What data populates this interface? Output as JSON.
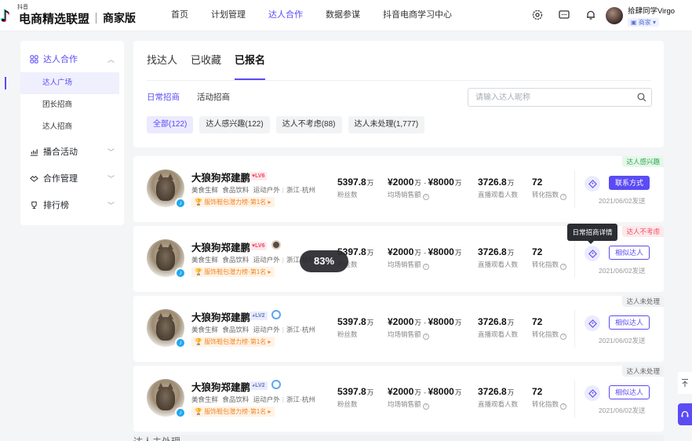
{
  "header": {
    "logo_small": "抖音",
    "brand": "电商精选联盟",
    "sub_brand": "商家版",
    "nav": [
      "首页",
      "计划管理",
      "达人合作",
      "数据参谋",
      "抖音电商学习中心"
    ],
    "nav_active": 2,
    "icons": [
      "gear-icon",
      "message-icon",
      "bell-icon"
    ],
    "user": {
      "name": "拾肆同学Virgo",
      "role": "商家"
    }
  },
  "sidebar": {
    "groups": [
      {
        "label": "达人合作",
        "icon": "grid-icon",
        "expanded": true,
        "active": true,
        "items": [
          "达人广场",
          "团长招商",
          "达人招商"
        ],
        "active_item": 0
      },
      {
        "label": "播合活动",
        "icon": "chart-icon",
        "expanded": false
      },
      {
        "label": "合作管理",
        "icon": "handshake-icon",
        "expanded": false
      },
      {
        "label": "排行榜",
        "icon": "trophy-icon",
        "expanded": false
      }
    ]
  },
  "main": {
    "tabs": [
      "找达人",
      "已收藏",
      "已报名"
    ],
    "active_tab": 2,
    "subtabs": [
      "日常招商",
      "活动招商"
    ],
    "active_subtab": 0,
    "search_placeholder": "请输入达人昵称",
    "chips": [
      "全部(122)",
      "达人感兴趣(122)",
      "达人不考虑(88)",
      "达人未处理(1,777)"
    ],
    "active_chip": 0
  },
  "metric_labels": {
    "fans": "粉丝数",
    "sales": "均场销售额",
    "viewers": "直播观看人数",
    "conversion": "转化指数"
  },
  "cards": [
    {
      "name": "大狼狗郑建鹏",
      "level": "LV6",
      "level_color": "red",
      "badge": null,
      "tags": [
        "美食生鲜",
        "食品饮料",
        "运动户外",
        "浙江·杭州"
      ],
      "rank": "服饰鞋包潜力榜·第1名",
      "fans": "5397.8",
      "fans_unit": "万",
      "sales_min": "¥2000",
      "sales_max": "¥8000",
      "sales_unit": "万",
      "viewers": "3726.8",
      "viewers_unit": "万",
      "conversion": "72",
      "action": "联系方式",
      "action_style": "solid",
      "date": "2021/06/02发送",
      "status": "达人感兴趣",
      "status_color": "green"
    },
    {
      "name": "大狼狗郑建鹏",
      "level": "LV6",
      "level_color": "red",
      "badge": "brown",
      "tags": [
        "美食生鲜",
        "食品饮料",
        "运动户外",
        "浙江·杭州"
      ],
      "rank": "服饰鞋包潜力榜·第1名",
      "fans": "5397.8",
      "fans_unit": "万",
      "sales_min": "¥2000",
      "sales_max": "¥8000",
      "sales_unit": "万",
      "viewers": "3726.8",
      "viewers_unit": "万",
      "conversion": "72",
      "action": "相似达人",
      "action_style": "ghost",
      "date": "2021/06/02发送",
      "status": "达人不考虑",
      "status_color": "red"
    },
    {
      "name": "大狼狗郑建鹏",
      "level": "LV2",
      "level_color": "blue",
      "badge": "blue",
      "tags": [
        "美食生鲜",
        "食品饮料",
        "运动户外",
        "浙江·杭州"
      ],
      "rank": "服饰鞋包潜力榜·第1名",
      "fans": "5397.8",
      "fans_unit": "万",
      "sales_min": "¥2000",
      "sales_max": "¥8000",
      "sales_unit": "万",
      "viewers": "3726.8",
      "viewers_unit": "万",
      "conversion": "72",
      "action": "相似达人",
      "action_style": "ghost",
      "date": "2021/06/02发送",
      "status": "达人未处理",
      "status_color": "gray"
    },
    {
      "name": "大狼狗郑建鹏",
      "level": "LV2",
      "level_color": "blue",
      "badge": "blue",
      "tags": [
        "美食生鲜",
        "食品饮料",
        "运动户外",
        "浙江·杭州"
      ],
      "rank": "服饰鞋包潜力榜·第1名",
      "fans": "5397.8",
      "fans_unit": "万",
      "sales_min": "¥2000",
      "sales_max": "¥8000",
      "sales_unit": "万",
      "viewers": "3726.8",
      "viewers_unit": "万",
      "conversion": "72",
      "action": "相似达人",
      "action_style": "ghost",
      "date": "2021/06/02发送",
      "status": "达人未处理",
      "status_color": "gray"
    }
  ],
  "peek_status": "达人未处理",
  "tooltip": "日常招商详情",
  "progress": {
    "label": "83%",
    "value": 0.83
  },
  "colors": {
    "accent": "#5a4bf5",
    "green": "#26a94d",
    "red": "#ef4b5e"
  }
}
